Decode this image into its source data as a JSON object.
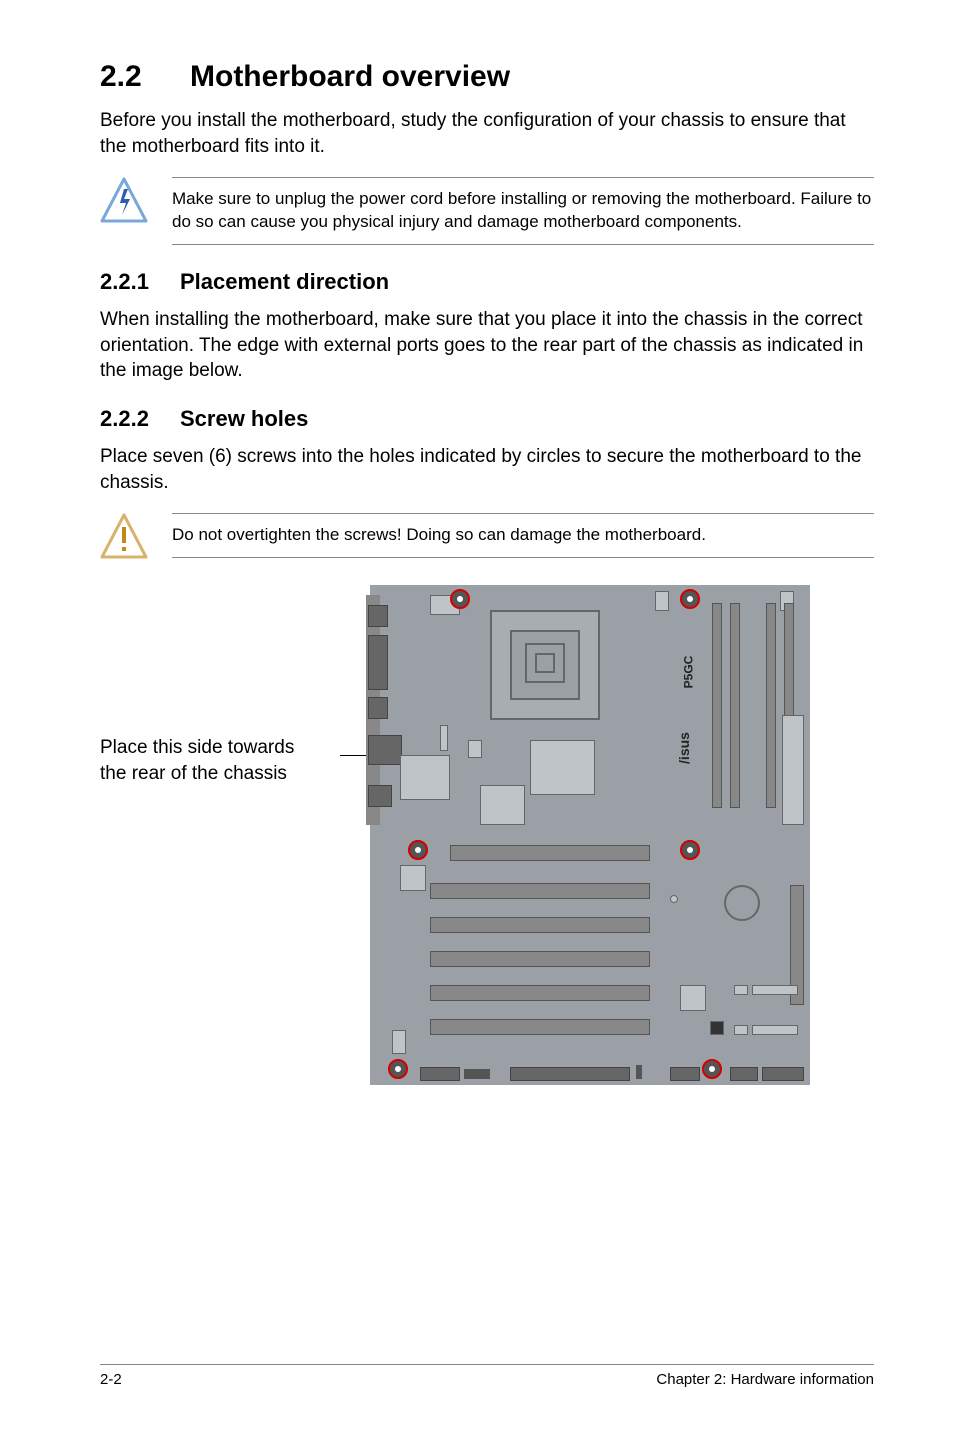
{
  "section": {
    "number": "2.2",
    "title": "Motherboard overview",
    "intro": "Before you install the motherboard, study the configuration of your chassis to ensure that the motherboard fits into it."
  },
  "warning1": "Make sure to unplug the power cord before installing or removing the motherboard. Failure to do so can cause you physical injury and damage motherboard components.",
  "sub1": {
    "number": "2.2.1",
    "title": "Placement direction",
    "body": "When installing the motherboard, make sure that you place it into the chassis in the correct orientation. The edge with external ports goes to the rear part of the chassis as indicated in the image below."
  },
  "sub2": {
    "number": "2.2.2",
    "title": "Screw holes",
    "body": "Place seven (6) screws into the holes indicated by circles to secure the motherboard to the chassis."
  },
  "caution": "Do not overtighten the screws! Doing so can damage the motherboard.",
  "diagram": {
    "side_label_line1": "Place this side towards",
    "side_label_line2": "the rear of the chassis",
    "brand": "/isus",
    "model": "P5GC"
  },
  "footer": {
    "page": "2-2",
    "chapter": "Chapter 2: Hardware information"
  }
}
